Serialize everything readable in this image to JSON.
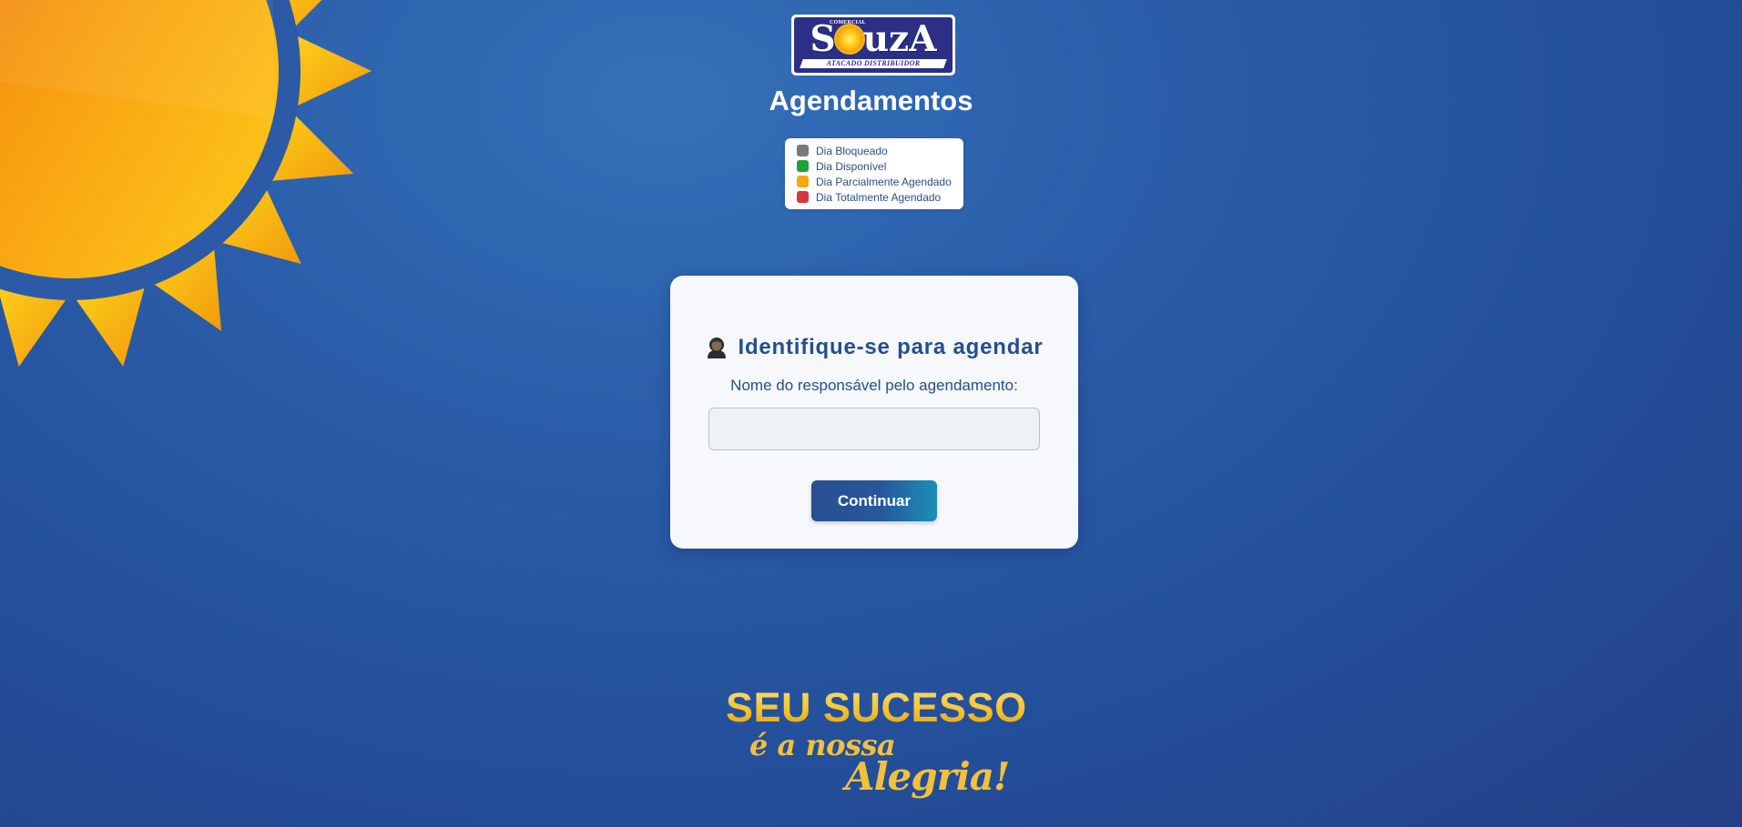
{
  "colors": {
    "background": "#2a5ca8",
    "sun": "#f8a70a",
    "primary_text": "#244f8f",
    "slogan_gold": "#f5c026"
  },
  "logo": {
    "small_text": "COMERCIAL",
    "brand": "SouzA",
    "tagline": "ATACADO DISTRIBUIDOR"
  },
  "header": {
    "title": "Agendamentos"
  },
  "legend": {
    "items": [
      {
        "label": "Dia Bloqueado",
        "color": "#7a7a7a"
      },
      {
        "label": "Dia Disponível",
        "color": "#1aa33a"
      },
      {
        "label": "Dia Parcialmente Agendado",
        "color": "#f5a812"
      },
      {
        "label": "Dia Totalmente Agendado",
        "color": "#d9343c"
      }
    ]
  },
  "form": {
    "icon": "person-icon",
    "heading": "Identifique-se para agendar",
    "label": "Nome do responsável pelo agendamento:",
    "input_value": "",
    "input_placeholder": "",
    "button_label": "Continuar"
  },
  "slogan": {
    "line1": "SEU SUCESSO",
    "line2": "é a nossa",
    "line3": "Alegria!"
  }
}
